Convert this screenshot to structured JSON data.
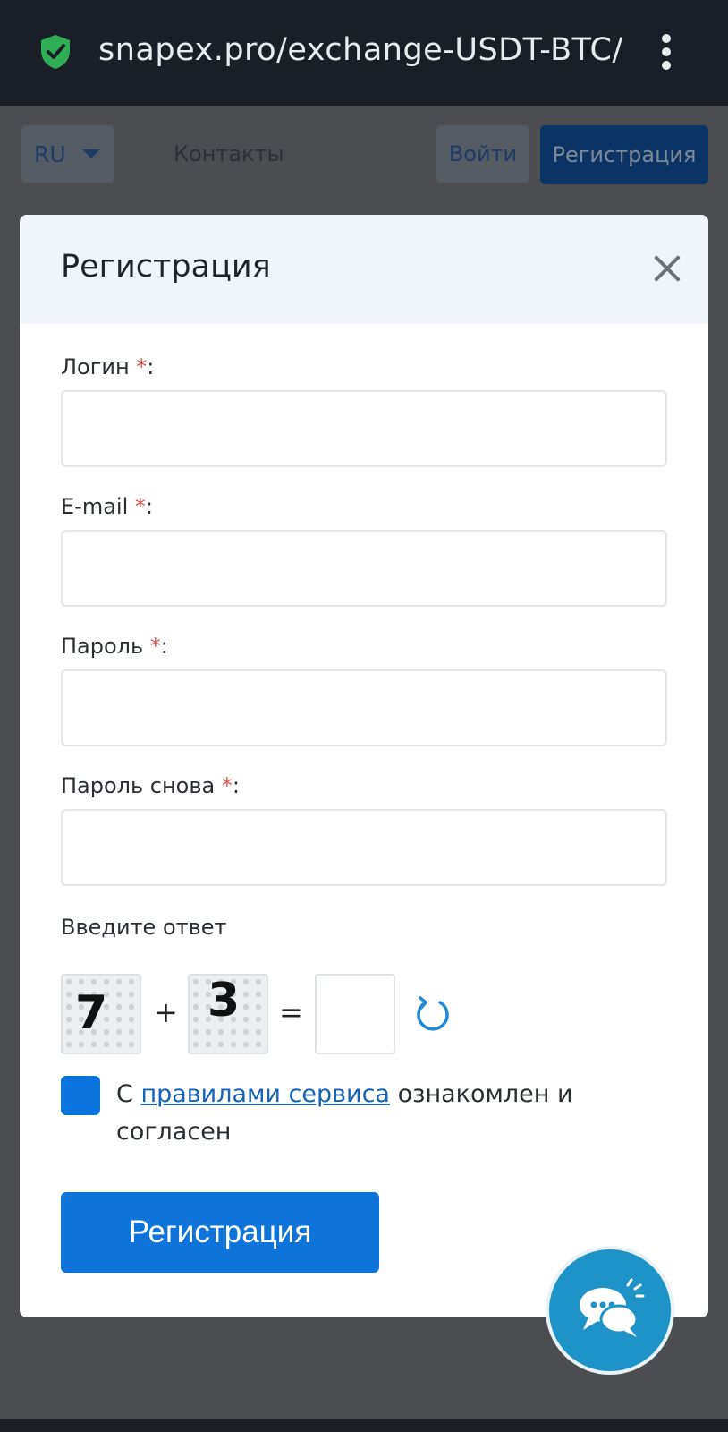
{
  "browser": {
    "url": "snapex.pro/exchange-USDT-BTC/",
    "icons": {
      "security": "shield-check-icon",
      "menu": "kebab-menu-icon"
    },
    "colors": {
      "shield": "#2fae55",
      "bar": "#1a1f27"
    }
  },
  "header": {
    "lang": "RU",
    "contacts": "Контакты",
    "login": "Войти",
    "register": "Регистрация"
  },
  "modal": {
    "title": "Регистрация",
    "fields": [
      {
        "label": "Логин",
        "required_mark": "*",
        "suffix": ":",
        "value": ""
      },
      {
        "label": "E-mail",
        "required_mark": "*",
        "suffix": ":",
        "value": ""
      },
      {
        "label": "Пароль",
        "required_mark": "*",
        "suffix": ":",
        "value": ""
      },
      {
        "label": "Пароль снова",
        "required_mark": "*",
        "suffix": ":",
        "value": ""
      }
    ],
    "captcha": {
      "prompt": "Введите ответ",
      "a": "7",
      "op": "+",
      "b": "3",
      "eq": "=",
      "answer": ""
    },
    "agreement": {
      "before": "С ",
      "link": "правилами сервиса",
      "after": " ознакомлен и согласен",
      "checked": true
    },
    "submit": "Регистрация"
  },
  "chat_widget": {
    "icon": "chat-bubbles-icon",
    "color": "#1d93c7"
  }
}
